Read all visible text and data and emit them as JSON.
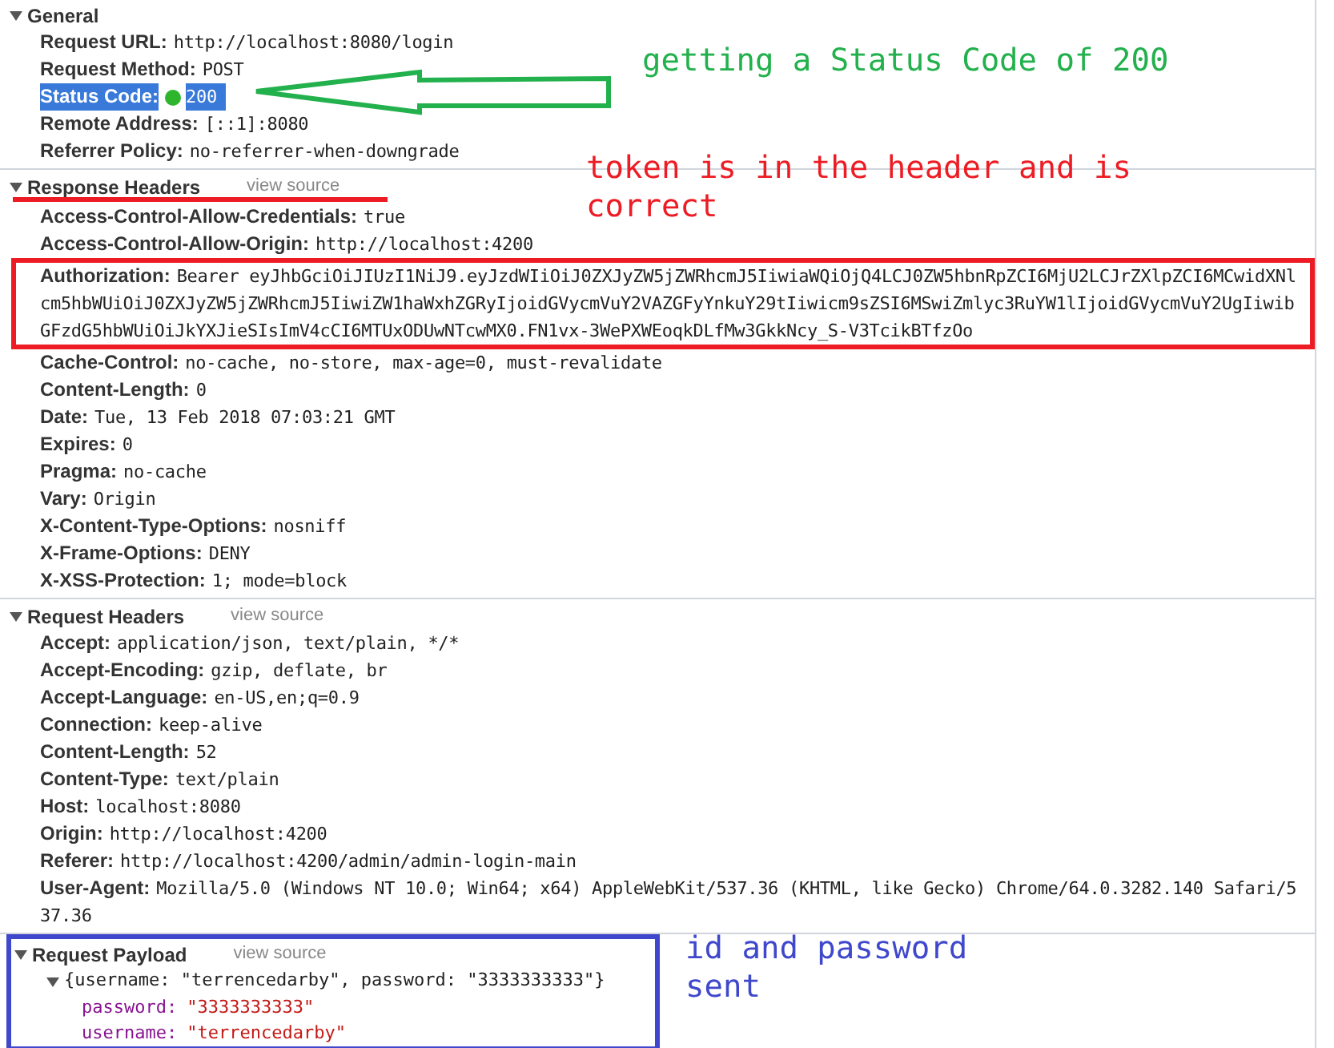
{
  "sections": [
    {
      "title": "General",
      "expanded": true,
      "rows": [
        {
          "name": "Request URL:",
          "value": [
            "http://localhost:8080/login"
          ],
          "highlighted": false
        },
        {
          "name": "Request Method:",
          "value": [
            "POST"
          ],
          "highlighted": false
        },
        {
          "name": "Status Code:",
          "value": [
            "200"
          ],
          "highlighted": true,
          "color": "#2db52d"
        },
        {
          "name": "Remote Address:",
          "value": [
            "[::1]:8080"
          ],
          "highlighted": false
        },
        {
          "name": "Referrer Policy:",
          "value": [
            "no-referrer-when-downgrade"
          ],
          "highlighted": false
        }
      ]
    },
    {
      "title": "Response Headers",
      "expanded": true,
      "view_source": "view source",
      "rows": [
        {
          "name": "Access-Control-Allow-Credentials:",
          "value": [
            "true"
          ],
          "highlighted": false
        },
        {
          "name": "Access-Control-Allow-Origin:",
          "value": [
            "http://localhost:4200"
          ],
          "highlighted": false
        },
        {
          "name": "Authorization:",
          "value": [
            "Bearer eyJhbGciOiJIUzI1NiJ9.eyJzdWIiOiJ0ZXJyZW5jZWRhcmJ5IiwiaWQiOjQ4LCJ0ZW5hbnRpZCI6MjU2LCJrZXlpZCI6MCwidXNl",
            "cm5hbWUiOiJ0ZXJyZW5jZWRhcmJ5IiwiZW1haWxhZGRyIjoidGVycmVuY2VAZGFyYnkuY29tIiwicm9sZSI6MSwiZmlyc3RuYW1lIjoidGVycmVuY2UgIiwib",
            "GFzdG5hbWUiOiJkYXJieSIsImV4cCI6MTUxODUwNTcwMX0.FN1vx-3WePXWEoqkDLfMw3GkkNcy_S-V3TcikBTfzOo"
          ],
          "highlighted": false
        },
        {
          "name": "Cache-Control:",
          "value": [
            "no-cache, no-store, max-age=0, must-revalidate"
          ],
          "highlighted": false
        },
        {
          "name": "Content-Length:",
          "value": [
            "0"
          ],
          "highlighted": false
        },
        {
          "name": "Date:",
          "value": [
            "Tue, 13 Feb 2018 07:03:21 GMT"
          ],
          "highlighted": false
        },
        {
          "name": "Expires:",
          "value": [
            "0"
          ],
          "highlighted": false
        },
        {
          "name": "Pragma:",
          "value": [
            "no-cache"
          ],
          "highlighted": false
        },
        {
          "name": "Vary:",
          "value": [
            "Origin"
          ],
          "highlighted": false
        },
        {
          "name": "X-Content-Type-Options:",
          "value": [
            "nosniff"
          ],
          "highlighted": false
        },
        {
          "name": "X-Frame-Options:",
          "value": [
            "DENY"
          ],
          "highlighted": false
        },
        {
          "name": "X-XSS-Protection:",
          "value": [
            "1; mode=block"
          ],
          "highlighted": false
        }
      ]
    },
    {
      "title": "Request Headers",
      "expanded": true,
      "view_source": "view source",
      "rows": [
        {
          "name": "Accept:",
          "value": [
            "application/json, text/plain, */*"
          ],
          "highlighted": false
        },
        {
          "name": "Accept-Encoding:",
          "value": [
            "gzip, deflate, br"
          ],
          "highlighted": false
        },
        {
          "name": "Accept-Language:",
          "value": [
            "en-US,en;q=0.9"
          ],
          "highlighted": false
        },
        {
          "name": "Connection:",
          "value": [
            "keep-alive"
          ],
          "highlighted": false
        },
        {
          "name": "Content-Length:",
          "value": [
            "52"
          ],
          "highlighted": false
        },
        {
          "name": "Content-Type:",
          "value": [
            "text/plain"
          ],
          "highlighted": false
        },
        {
          "name": "Host:",
          "value": [
            "localhost:8080"
          ],
          "highlighted": false
        },
        {
          "name": "Origin:",
          "value": [
            "http://localhost:4200"
          ],
          "highlighted": false
        },
        {
          "name": "Referer:",
          "value": [
            "http://localhost:4200/admin/admin-login-main"
          ],
          "highlighted": false
        },
        {
          "name": "User-Agent:",
          "value": [
            "Mozilla/5.0 (Windows NT 10.0; Win64; x64) AppleWebKit/537.36 (KHTML, like Gecko) Chrome/64.0.3282.140 Safari/5",
            "37.36"
          ],
          "highlighted": false
        }
      ]
    },
    {
      "title": "Request Payload",
      "expanded": true,
      "view_source": "view source",
      "payload": {
        "summary": "{username: \"terrencedarby\", password: \"3333333333\"}",
        "expanded": true,
        "properties": [
          {
            "key": "password:",
            "value": "\"3333333333\""
          },
          {
            "key": "username:",
            "value": "\"terrencedarby\""
          }
        ]
      }
    }
  ],
  "annotations": [
    {
      "kind": "note",
      "text": "getting a Status Code of 200",
      "color": "#22b14c"
    },
    {
      "kind": "note",
      "text": "token is in the header and is correct",
      "color": "#ed1c24"
    },
    {
      "kind": "note",
      "text": "id and password sent",
      "color": "#3f48cc"
    }
  ]
}
